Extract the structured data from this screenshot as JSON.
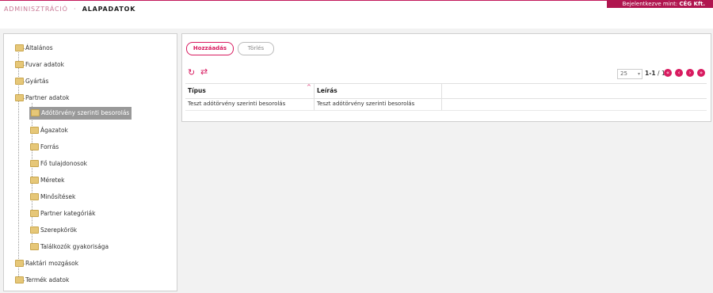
{
  "header": {
    "breadcrumb_section": "ADMINISZTRÁCIÓ",
    "breadcrumb_separator": "·",
    "breadcrumb_page": "ALAPADATOK",
    "login_prefix": "Bejelentkezve mint:",
    "login_company": "CÉG Kft."
  },
  "tree": {
    "items": [
      {
        "label": "Általános",
        "selected": false
      },
      {
        "label": "Fuvar adatok",
        "selected": false
      },
      {
        "label": "Gyártás",
        "selected": false
      },
      {
        "label": "Partner adatok",
        "selected": false
      },
      {
        "label": "Adótörvény szerinti besorolás",
        "selected": true
      },
      {
        "label": "Ágazatok",
        "selected": false
      },
      {
        "label": "Forrás",
        "selected": false
      },
      {
        "label": "Fő tulajdonosok",
        "selected": false
      },
      {
        "label": "Méretek",
        "selected": false
      },
      {
        "label": "Minősítések",
        "selected": false
      },
      {
        "label": "Partner kategóriák",
        "selected": false
      },
      {
        "label": "Szerepkörök",
        "selected": false
      },
      {
        "label": "Találkozók gyakorisága",
        "selected": false
      },
      {
        "label": "Raktári mozgások",
        "selected": false
      },
      {
        "label": "Termék adatok",
        "selected": false
      }
    ]
  },
  "toolbar": {
    "add_label": "Hozzáadás",
    "delete_label": "Törlés",
    "refresh_icon": "refresh-icon",
    "swap_icon": "swap-icon"
  },
  "pagination": {
    "page_size": "25",
    "range": "1-1",
    "total": "/ 1"
  },
  "table": {
    "columns": [
      "Típus",
      "Leírás"
    ],
    "rows": [
      [
        "Teszt adótörvény szerinti besorolás",
        "Teszt adótörvény szerinti besorolás"
      ]
    ]
  },
  "colors": {
    "accent": "#d81b60",
    "brand_bar": "#b0154f"
  }
}
